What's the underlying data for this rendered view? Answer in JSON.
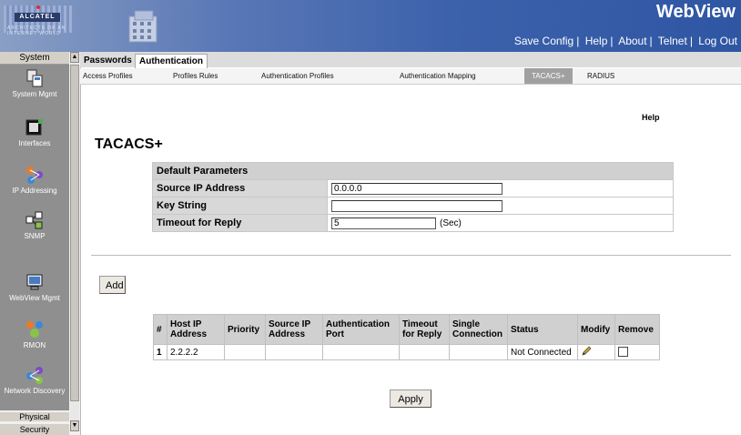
{
  "header": {
    "brand": "ALCATEL",
    "brand_tagline": "ARCHITECTS OF AN INTERNET WORLD",
    "app_title": "WebView",
    "links": [
      "Save Config",
      "Help",
      "About",
      "Telnet",
      "Log Out"
    ]
  },
  "sidebar": {
    "header_label": "System",
    "items": [
      {
        "label": "System Mgmt",
        "icon": "system-mgmt-icon"
      },
      {
        "label": "Interfaces",
        "icon": "interfaces-icon"
      },
      {
        "label": "IP Addressing",
        "icon": "ip-addressing-icon"
      },
      {
        "label": "SNMP",
        "icon": "snmp-icon"
      },
      {
        "label": "WebView Mgmt",
        "icon": "webview-mgmt-icon"
      },
      {
        "label": "RMON",
        "icon": "rmon-icon"
      },
      {
        "label": "Network Discovery",
        "icon": "network-discovery-icon"
      }
    ],
    "physical_label": "Physical",
    "security_label": "Security"
  },
  "tabs": {
    "passwords": "Passwords",
    "authentication": "Authentication"
  },
  "subtabs": [
    "Access Profiles",
    "Profiles Rules",
    "Authentication Profiles",
    "Authentication Mapping",
    "TACACS+",
    "RADIUS"
  ],
  "help_label": "Help",
  "page_title": "TACACS+",
  "params": {
    "header": "Default Parameters",
    "source_ip_label": "Source IP Address",
    "source_ip_value": "0.0.0.0",
    "key_string_label": "Key String",
    "key_string_value": "",
    "timeout_label": "Timeout for Reply",
    "timeout_value": "5",
    "timeout_unit": "(Sec)"
  },
  "add_label": "Add",
  "servers": {
    "columns": [
      "#",
      "Host IP Address",
      "Priority",
      "Source IP Address",
      "Authentication Port",
      "Timeout for Reply",
      "Single Connection",
      "Status",
      "Modify",
      "Remove"
    ],
    "rows": [
      {
        "num": "1",
        "host_ip": "2.2.2.2",
        "priority": "",
        "source_ip": "",
        "auth_port": "",
        "timeout": "",
        "single_connection": "",
        "status": "Not Connected"
      }
    ]
  },
  "apply_label": "Apply"
}
